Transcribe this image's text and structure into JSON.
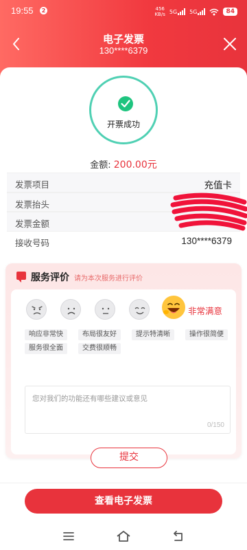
{
  "status_bar": {
    "time": "19:55",
    "notification_badge": "2",
    "net_speed_top": "456",
    "net_speed_bottom": "KB/s",
    "net1": "5G",
    "net2": "5G",
    "battery": "84"
  },
  "nav": {
    "title": "电子发票",
    "subtitle": "130****6379",
    "back_icon": "chevron-left-icon",
    "close_icon": "close-icon"
  },
  "status": {
    "text": "开票成功",
    "icon": "check-circle-icon"
  },
  "amount": {
    "label": "金额: ",
    "value": "200.00元"
  },
  "info_rows": [
    {
      "label": "发票项目",
      "value": "充值卡"
    },
    {
      "label": "发票抬头",
      "value": ""
    },
    {
      "label": "发票金额",
      "value": ""
    },
    {
      "label": "接收号码",
      "value": "130****6379"
    }
  ],
  "review": {
    "title": "服务评价",
    "hint": "请为本次服务进行评价",
    "faces": [
      "angry-face-icon",
      "frown-face-icon",
      "neutral-face-icon",
      "smile-face-icon",
      "grin-face-icon"
    ],
    "selected_label": "非常满意",
    "tags": [
      "响应非常快",
      "布局很友好",
      "提示特清晰",
      "操作很简便",
      "服务很全面",
      "交费很顺畅"
    ],
    "feedback_placeholder": "您对我们的功能还有哪些建议或意见",
    "feedback_count": "0/150",
    "submit_label": "提交"
  },
  "cta_label": "查看电子发票",
  "colors": {
    "accent": "#e8333c",
    "success": "#1ec47f",
    "ring": "#4fd0b3"
  }
}
